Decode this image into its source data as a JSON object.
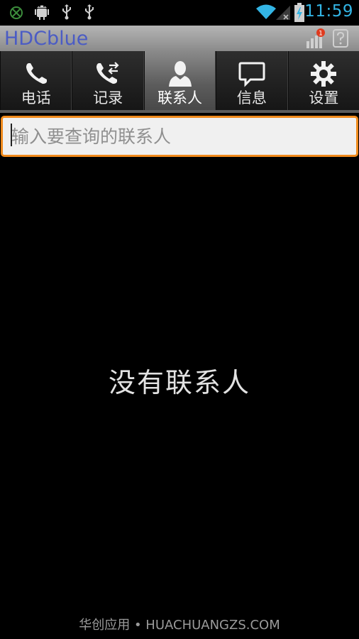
{
  "status_bar": {
    "time": "11:59",
    "icons": [
      "xbox-icon",
      "android-debug-icon",
      "usb-icon",
      "usb-icon",
      "wifi-icon",
      "no-signal-icon",
      "battery-charging-icon"
    ],
    "accent_color": "#33b5e5"
  },
  "app": {
    "title": "HDCblue",
    "title_color": "#4b5cc4",
    "notification_badge": "1"
  },
  "tabs": [
    {
      "label": "电话",
      "icon": "phone-icon"
    },
    {
      "label": "记录",
      "icon": "call-log-icon"
    },
    {
      "label": "联系人",
      "icon": "contact-icon",
      "active": true
    },
    {
      "label": "信息",
      "icon": "message-icon"
    },
    {
      "label": "设置",
      "icon": "gear-icon"
    }
  ],
  "search": {
    "placeholder": "输入要查询的联系人",
    "value": "",
    "border_color": "#f08a1c"
  },
  "empty_state": {
    "text": "没有联系人"
  },
  "footer": {
    "text": "华创应用 • HUACHUANGZS.COM"
  }
}
